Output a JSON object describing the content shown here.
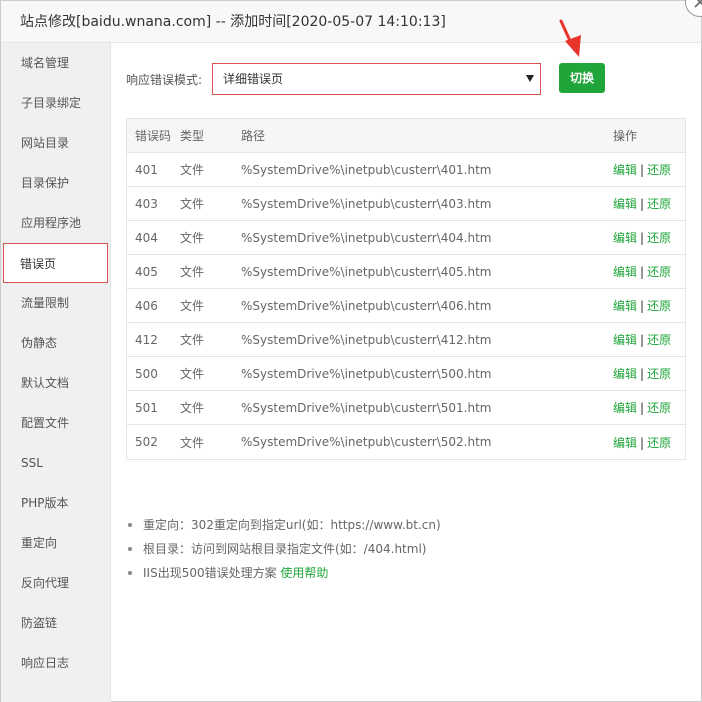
{
  "window": {
    "title": "站点修改[baidu.wnana.com] -- 添加时间[2020-05-07 14:10:13]"
  },
  "sidebar": {
    "items": [
      {
        "label": "域名管理"
      },
      {
        "label": "子目录绑定"
      },
      {
        "label": "网站目录"
      },
      {
        "label": "目录保护"
      },
      {
        "label": "应用程序池"
      },
      {
        "label": "错误页",
        "active": true
      },
      {
        "label": "流量限制"
      },
      {
        "label": "伪静态"
      },
      {
        "label": "默认文档"
      },
      {
        "label": "配置文件"
      },
      {
        "label": "SSL"
      },
      {
        "label": "PHP版本"
      },
      {
        "label": "重定向"
      },
      {
        "label": "反向代理"
      },
      {
        "label": "防盗链"
      },
      {
        "label": "响应日志"
      }
    ]
  },
  "mode": {
    "label": "响应错误模式:",
    "selected": "详细错误页",
    "switch_label": "切换"
  },
  "table": {
    "headers": {
      "code": "错误码",
      "type": "类型",
      "path": "路径",
      "ops": "操作"
    },
    "rows": [
      {
        "code": "401",
        "type": "文件",
        "path": "%SystemDrive%\\inetpub\\custerr\\401.htm"
      },
      {
        "code": "403",
        "type": "文件",
        "path": "%SystemDrive%\\inetpub\\custerr\\403.htm"
      },
      {
        "code": "404",
        "type": "文件",
        "path": "%SystemDrive%\\inetpub\\custerr\\404.htm"
      },
      {
        "code": "405",
        "type": "文件",
        "path": "%SystemDrive%\\inetpub\\custerr\\405.htm"
      },
      {
        "code": "406",
        "type": "文件",
        "path": "%SystemDrive%\\inetpub\\custerr\\406.htm"
      },
      {
        "code": "412",
        "type": "文件",
        "path": "%SystemDrive%\\inetpub\\custerr\\412.htm"
      },
      {
        "code": "500",
        "type": "文件",
        "path": "%SystemDrive%\\inetpub\\custerr\\500.htm"
      },
      {
        "code": "501",
        "type": "文件",
        "path": "%SystemDrive%\\inetpub\\custerr\\501.htm"
      },
      {
        "code": "502",
        "type": "文件",
        "path": "%SystemDrive%\\inetpub\\custerr\\502.htm"
      }
    ],
    "edit_label": "编辑",
    "separator": "|",
    "restore_label": "还原"
  },
  "tips": {
    "items": [
      {
        "text": "重定向：302重定向到指定url(如：https://www.bt.cn)"
      },
      {
        "text": "根目录：访问到网站根目录指定文件(如：/404.html)"
      },
      {
        "text": "IIS出现500错误处理方案 ",
        "link": "使用帮助"
      }
    ]
  },
  "colors": {
    "accent": "#20a53a",
    "highlight": "#d9534f",
    "arrow": "#e8342b"
  },
  "icons": {
    "close": "close-icon",
    "dropdown": "chevron-down-icon",
    "pointer": "red-arrow-icon"
  }
}
